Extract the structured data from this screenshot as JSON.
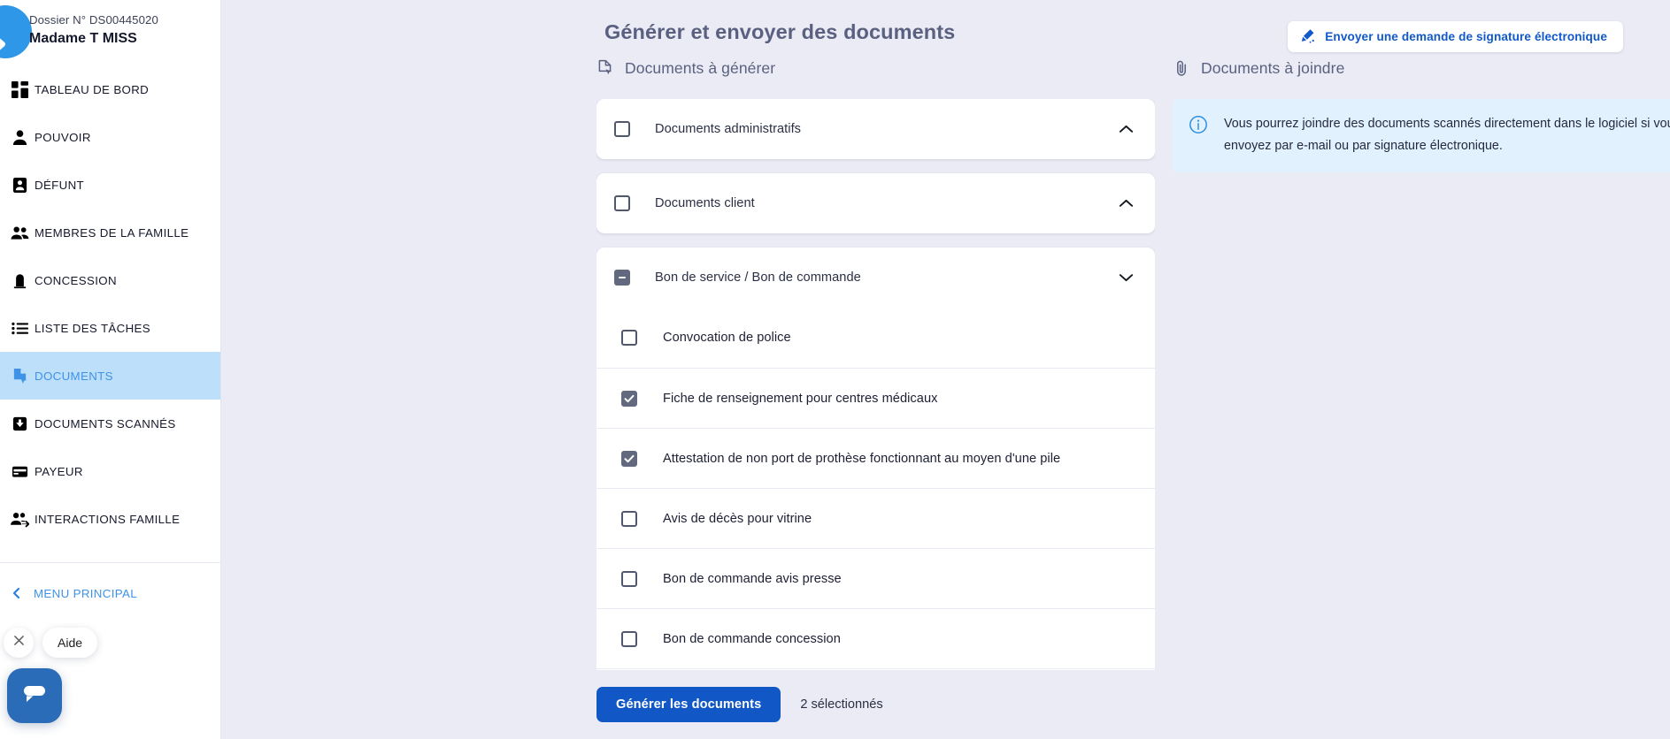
{
  "sidebar": {
    "dossier_number": "Dossier N° DS00445020",
    "client_name": "Madame T MISS",
    "items": [
      {
        "label": "TABLEAU DE BORD",
        "icon": "dashboard-icon",
        "active": false
      },
      {
        "label": "POUVOIR",
        "icon": "person-icon",
        "active": false
      },
      {
        "label": "DÉFUNT",
        "icon": "id-card-icon",
        "active": false
      },
      {
        "label": "MEMBRES DE LA FAMILLE",
        "icon": "people-icon",
        "active": false
      },
      {
        "label": "CONCESSION",
        "icon": "headstone-icon",
        "active": false
      },
      {
        "label": "LISTE DES TÂCHES",
        "icon": "list-icon",
        "active": false
      },
      {
        "label": "DOCUMENTS",
        "icon": "document-cursor-icon",
        "active": true
      },
      {
        "label": "DOCUMENTS SCANNÉS",
        "icon": "download-box-icon",
        "active": false
      },
      {
        "label": "PAYEUR",
        "icon": "credit-card-icon",
        "active": false
      },
      {
        "label": "INTERACTIONS FAMILLE",
        "icon": "people-arrow-icon",
        "active": false
      }
    ],
    "menu_principal": "MENU PRINCIPAL",
    "chat": {
      "help_label": "Aide",
      "close_icon": "close-icon",
      "launcher_icon": "chat-bubble-icon"
    }
  },
  "header": {
    "title": "Générer et envoyer des documents",
    "esign_button": "Envoyer une demande de signature électronique",
    "esign_icon": "signature-pen-icon"
  },
  "left_panel": {
    "section_title": "Documents à générer",
    "section_icon": "document-cursor-icon",
    "groups": [
      {
        "label": "Documents administratifs",
        "checkbox_state": "unchecked",
        "chevron": "chevron-up-icon",
        "children": []
      },
      {
        "label": "Documents client",
        "checkbox_state": "unchecked",
        "chevron": "chevron-up-icon",
        "children": []
      },
      {
        "label": "Bon de service / Bon de commande",
        "checkbox_state": "indeterminate",
        "chevron": "chevron-down-icon",
        "children": [
          {
            "label": "Convocation de police",
            "checkbox_state": "unchecked"
          },
          {
            "label": "Fiche de renseignement pour centres médicaux",
            "checkbox_state": "checked"
          },
          {
            "label": "Attestation de non port de prothèse fonctionnant au moyen d'une pile",
            "checkbox_state": "checked"
          },
          {
            "label": "Avis de décès pour vitrine",
            "checkbox_state": "unchecked"
          },
          {
            "label": "Bon de commande avis presse",
            "checkbox_state": "unchecked"
          },
          {
            "label": "Bon de commande concession",
            "checkbox_state": "unchecked"
          },
          {
            "label": "",
            "checkbox_state": "unchecked"
          }
        ]
      }
    ]
  },
  "right_panel": {
    "section_title": "Documents à joindre",
    "section_icon": "paperclip-icon",
    "callout_icon": "info-icon",
    "callout_text": "Vous pourrez joindre des documents scannés directement dans le logiciel si vous les envoyez par e-mail ou par signature électronique."
  },
  "footer": {
    "generate_button": "Générer les documents",
    "selected_count": "2 sélectionnés"
  },
  "colors": {
    "accent_blue": "#1257c6",
    "link_blue": "#3e93e8",
    "active_nav_bg": "#bddffa",
    "page_bg": "#ebebf5",
    "callout_bg": "#e1f1fd",
    "checkbox_fill": "#62697e"
  }
}
